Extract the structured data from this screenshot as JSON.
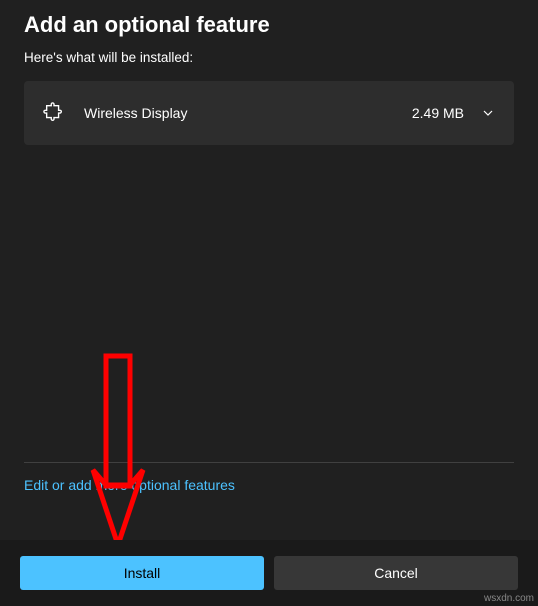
{
  "header": {
    "title": "Add an optional feature",
    "subtitle": "Here's what will be installed:"
  },
  "features": [
    {
      "icon": "puzzle-icon",
      "name": "Wireless Display",
      "size": "2.49 MB"
    }
  ],
  "editLink": "Edit or add more optional features",
  "buttons": {
    "install": "Install",
    "cancel": "Cancel"
  },
  "watermark": "wsxdn.com",
  "colors": {
    "accent": "#4cc2ff",
    "background": "#202020",
    "rowBackground": "#2d2d2d",
    "footerBackground": "#1a1a1a",
    "annotationArrow": "#ff0000"
  }
}
